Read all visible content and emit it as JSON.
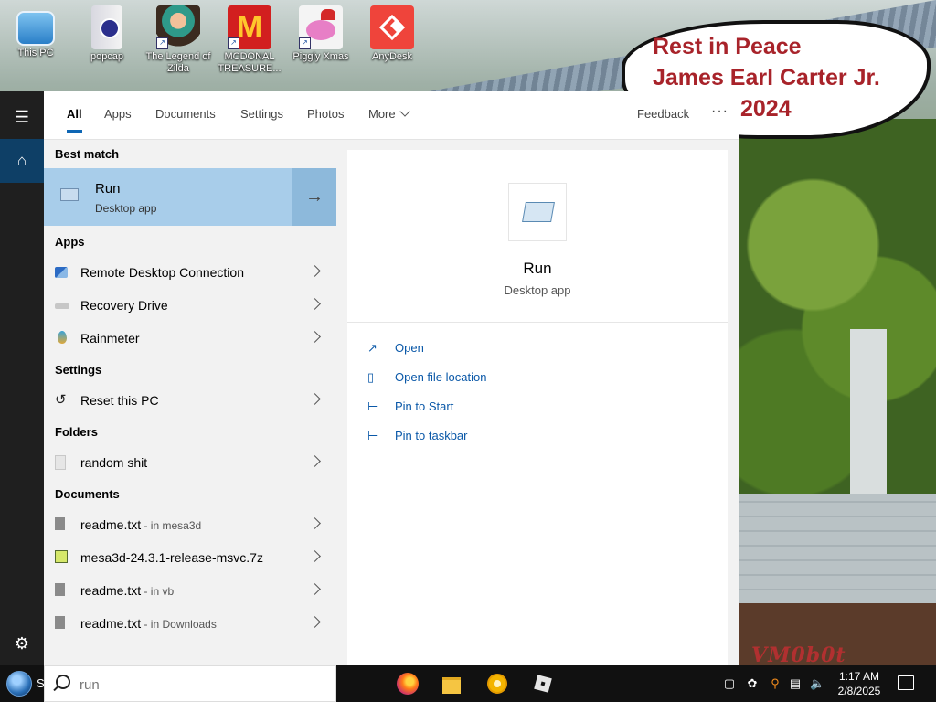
{
  "desktop": {
    "icons": [
      {
        "label": "This PC",
        "name": "this-pc-icon"
      },
      {
        "label": "popcap",
        "name": "popcap-icon"
      },
      {
        "label": "The Legend of Zilda",
        "name": "legend-of-zilda-icon"
      },
      {
        "label": "MCDONAL TREASURE...",
        "name": "mcdonal-treasure-icon"
      },
      {
        "label": "Piggly Xmas",
        "name": "piggly-xmas-icon"
      },
      {
        "label": "AnyDesk",
        "name": "anydesk-icon"
      }
    ],
    "bubble_lines": [
      "Rest in Peace",
      "James Earl Carter Jr.",
      "2024"
    ],
    "watermark": "VM0b0t"
  },
  "search_tabs": {
    "all": "All",
    "apps": "Apps",
    "documents": "Documents",
    "settings": "Settings",
    "photos": "Photos",
    "more": "More",
    "feedback": "Feedback",
    "ellipsis": "···"
  },
  "results": {
    "best_match_header": "Best match",
    "best_match": {
      "title": "Run",
      "subtitle": "Desktop app",
      "arrow": "→"
    },
    "apps_header": "Apps",
    "apps": [
      {
        "label": "Remote Desktop Connection"
      },
      {
        "label": "Recovery Drive"
      },
      {
        "label": "Rainmeter"
      }
    ],
    "settings_header": "Settings",
    "settings": [
      {
        "label": "Reset this PC"
      }
    ],
    "folders_header": "Folders",
    "folders": [
      {
        "label": "random shit"
      }
    ],
    "documents_header": "Documents",
    "documents": [
      {
        "label": "readme.txt",
        "location": " - in mesa3d"
      },
      {
        "label": "mesa3d-24.3.1-release-msvc.7z",
        "location": ""
      },
      {
        "label": "readme.txt",
        "location": " - in vb"
      },
      {
        "label": "readme.txt",
        "location": " - in Downloads"
      }
    ]
  },
  "detail": {
    "name": "Run",
    "kind": "Desktop app",
    "actions": [
      {
        "label": "Open",
        "icon": "open-icon"
      },
      {
        "label": "Open file location",
        "icon": "file-location-icon"
      },
      {
        "label": "Pin to Start",
        "icon": "pin-icon"
      },
      {
        "label": "Pin to taskbar",
        "icon": "pin-icon"
      }
    ]
  },
  "taskbar": {
    "start_letter": "S",
    "search_value": "run",
    "apps": [
      "firefox-icon",
      "file-explorer-icon",
      "chrome-canary-icon",
      "roblox-icon"
    ],
    "clock_time": "1:17 AM",
    "clock_date": "2/8/2025"
  },
  "colors": {
    "accent": "#0e66b4",
    "best_match_bg": "#a8cdea",
    "link": "#0a58a8",
    "bubble_text": "#a8232a"
  }
}
